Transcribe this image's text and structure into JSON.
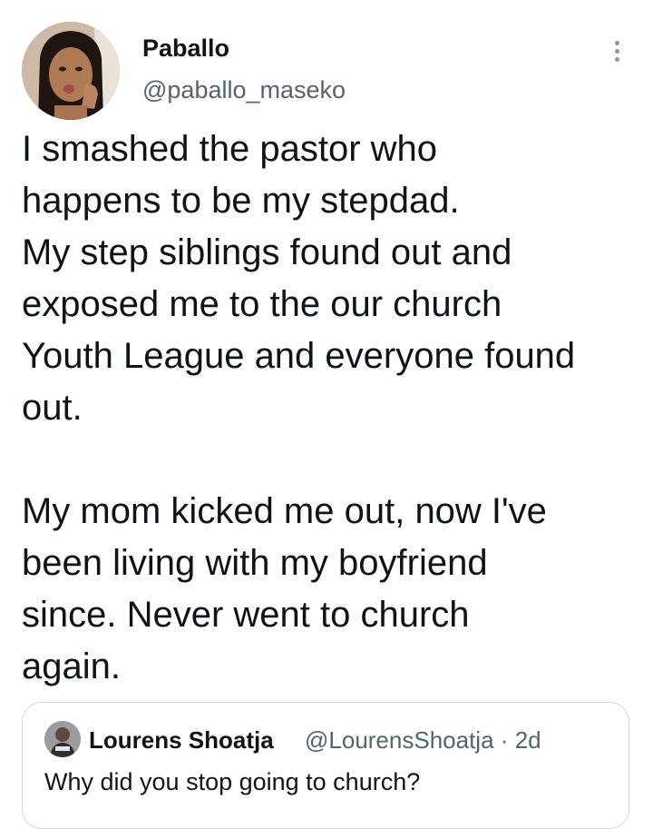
{
  "tweet": {
    "author": {
      "display_name": "Paballo",
      "handle": "@paballo_maseko",
      "avatar": "profile-photo"
    },
    "more_icon": "more-vertical-icon",
    "text": "I smashed the pastor who\nhappens to be my stepdad.\nMy step siblings found out and\nexposed me to the our church\nYouth League and everyone found\nout.\n\nMy mom kicked me out, now I've\nbeen living with my boyfriend\nsince. Never went to church\nagain."
  },
  "quoted_tweet": {
    "display_name": "Lourens Shoatja",
    "handle": "@LourensShoatja",
    "separator": "·",
    "time": "2d",
    "text": "Why did you stop going to church?"
  }
}
